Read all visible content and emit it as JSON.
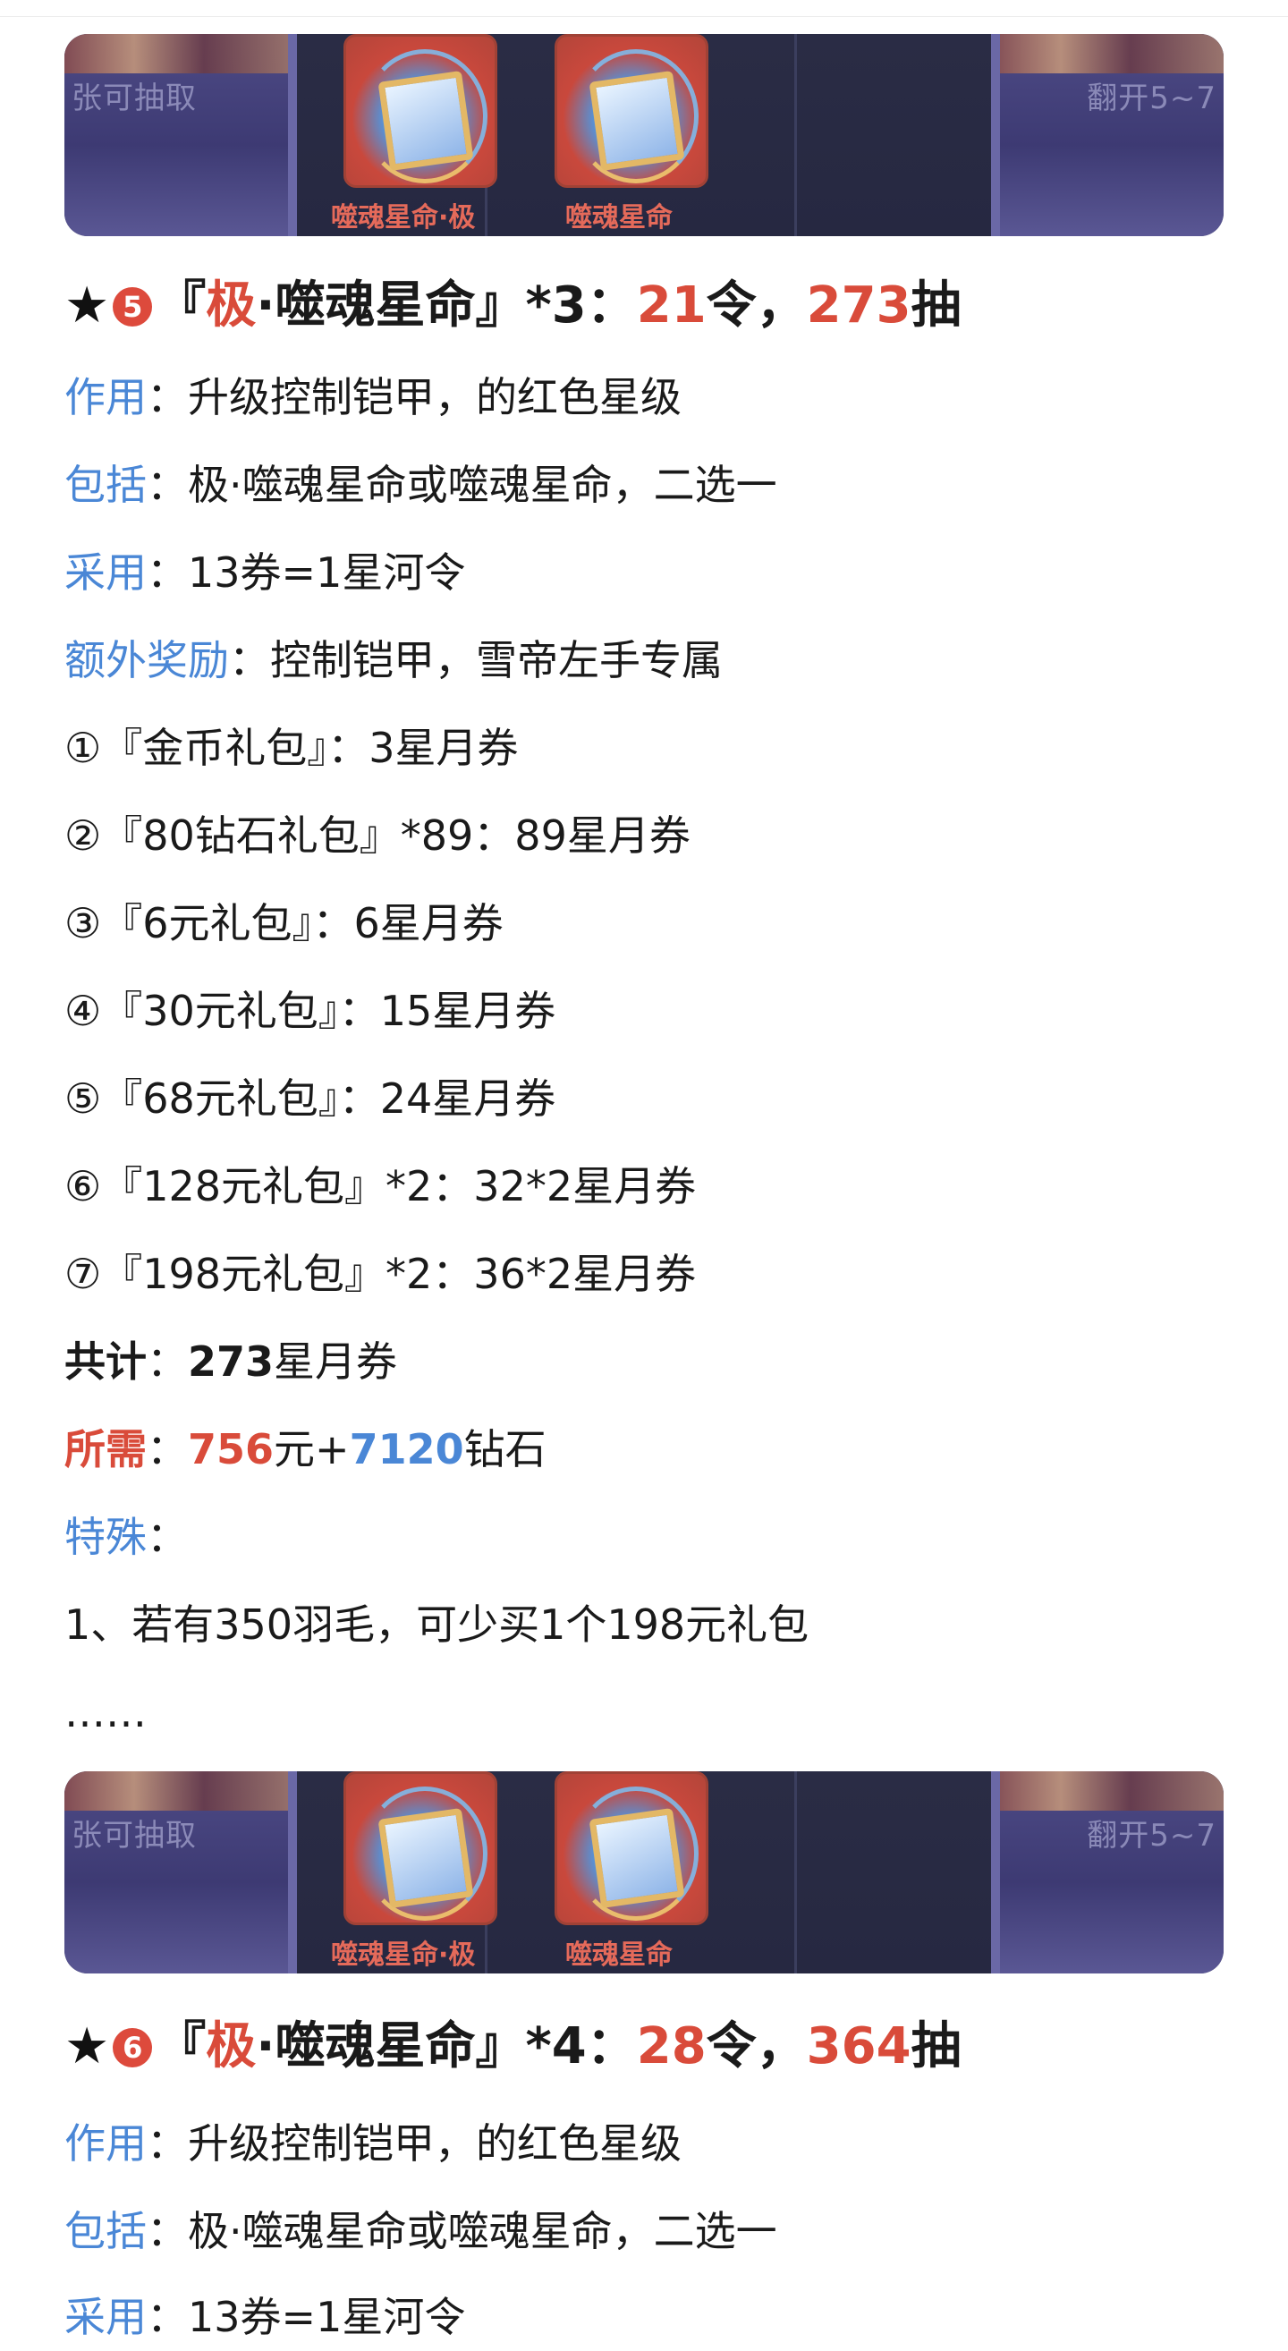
{
  "colors": {
    "accent_blue": "#4a87d6",
    "accent_red": "#d94b3a"
  },
  "banner": {
    "left_caption": "张可抽取",
    "right_caption": "翻开5~7",
    "card1_label": "噬魂星命·极",
    "card2_label": "噬魂星命"
  },
  "section1": {
    "star": "★",
    "number": "5",
    "title_open": "『",
    "title_ji": "极",
    "title_rest": "·噬魂星命』*3：",
    "ling": "21",
    "ling_unit": "令，",
    "chou": "273",
    "chou_unit": "抽",
    "effect_label": "作用",
    "effect_text": "：升级控制铠甲，的红色星级",
    "include_label": "包括",
    "include_text": "：极·噬魂星命或噬魂星命，二选一",
    "use_label": "采用",
    "use_text": "：13券=1星河令",
    "bonus_label": "额外奖励",
    "bonus_text": "：控制铠甲，雪帝左手专属",
    "items": [
      "①『金币礼包』：3星月券",
      "②『80钻石礼包』*89：89星月券",
      "③『6元礼包』：6星月券",
      "④『30元礼包』：15星月券",
      "⑤『68元礼包』：24星月券",
      "⑥『128元礼包』*2：32*2星月券",
      "⑦『198元礼包』*2：36*2星月券"
    ],
    "total_label": "共计",
    "total_sep": "：",
    "total_value": "273",
    "total_unit": "星月券",
    "need_label": "所需",
    "need_sep": "：",
    "need_yuan": "756",
    "need_yuan_unit": "元+",
    "need_diamond": "7120",
    "need_diamond_unit": "钻石",
    "special_label": "特殊",
    "special_sep": "：",
    "special_1": "1、若有350羽毛，可少买1个198元礼包",
    "ellipsis": "……"
  },
  "section2": {
    "star": "★",
    "number": "6",
    "title_open": "『",
    "title_ji": "极",
    "title_rest": "·噬魂星命』*4：",
    "ling": "28",
    "ling_unit": "令，",
    "chou": "364",
    "chou_unit": "抽",
    "effect_label": "作用",
    "effect_text": "：升级控制铠甲，的红色星级",
    "include_label": "包括",
    "include_text": "：极·噬魂星命或噬魂星命，二选一",
    "use_label": "采用",
    "use_text": "：13券=1星河令"
  }
}
